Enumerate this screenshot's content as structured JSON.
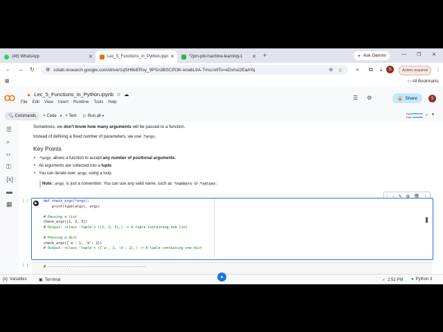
{
  "browser": {
    "tabs": [
      {
        "title": "(46) WhatsApp",
        "color": "#25d366"
      },
      {
        "title": "Lec_5_Functions_in_Python.ipyn",
        "color": "#e8710a"
      },
      {
        "title": "*2pm-pkt-machine-learning-1",
        "color": "#34a853"
      }
    ],
    "new_tab": "+",
    "ask_gemini": "Ask Gemini",
    "url": "colab.research.google.com/drive/1qSH6bERsy_9PSn3BSCPi3K-kna6L9A-T#scrollTo=eDxhsl2EaAYq",
    "action_required": "Action required",
    "all_bookmarks": "All Bookmarks",
    "profile_initial": "S"
  },
  "colab": {
    "notebook_name": "Lec_5_Functions_in_Python.ipynb",
    "menus": [
      "File",
      "Edit",
      "View",
      "Insert",
      "Runtime",
      "Tools",
      "Help"
    ],
    "share_label": "Share",
    "toolbar": {
      "commands": "Commands",
      "code": "+ Code",
      "text": "+ Text",
      "run_all": "Run all"
    },
    "ram": "RAM",
    "disk": "Disk"
  },
  "notebook": {
    "para1_pre": "Sometimes, we ",
    "para1_bold": "don't know how many arguments",
    "para1_post": " will be passed to a function.",
    "para2_pre": "Instead of defining a fixed number of parameters, we use ",
    "para2_code": "*args",
    "para2_post": ".",
    "heading": "Key Points",
    "bullet1_code": "*args",
    "bullet1_pre": " allows a function to accept ",
    "bullet1_bold": "any number of positional arguments",
    "bullet1_post": ".",
    "bullet2_pre": "All arguments are collected into a ",
    "bullet2_bold": "tuple",
    "bullet2_post": ".",
    "bullet3_pre": "You can iterate over ",
    "bullet3_code": "args",
    "bullet3_post": " using a loop.",
    "note_label": "Note:",
    "note_code1": "args",
    "note_mid": " is just a convention. You can use any valid name, such as ",
    "note_code2": "*numbers",
    "note_or": " or ",
    "note_code3": "*values",
    "note_end": ".",
    "cell_bracket": "[ ]",
    "code_line1": "def check_args(*args):",
    "code_line2": "    print(type(args), args)",
    "code_line3": "# Passing a list",
    "code_line4": "check_args([1, 2, 3])",
    "code_line5": "# Output: <class 'tuple'> ([1, 2, 3],) -> A tuple containing one list",
    "code_line6": "# Passing a dict",
    "code_line7": "check_args({'a': 1, 'b': 2})",
    "code_line8": "# Output: <class 'tuple'> ({'a': 1, 'b': 2},) -> A tuple containing one dict",
    "cell2_code": "# -----------------------------------------------"
  },
  "statusbar": {
    "variables": "Variables",
    "terminal": "Terminal",
    "time": "2:52 PM",
    "runtime": "Python 3"
  }
}
